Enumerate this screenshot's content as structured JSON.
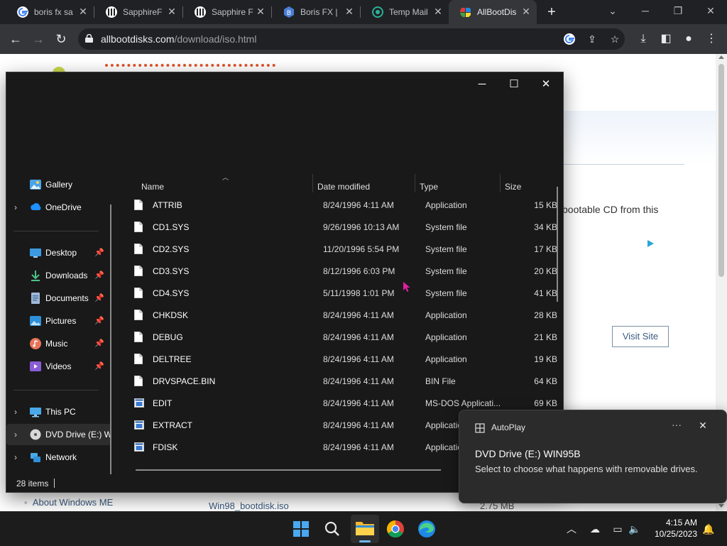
{
  "browser": {
    "tabs": [
      {
        "label": "boris fx sa",
        "icon": "google-icon"
      },
      {
        "label": "SapphireF",
        "icon": "museum-icon"
      },
      {
        "label": "Sapphire F",
        "icon": "museum-icon"
      },
      {
        "label": "Boris FX |",
        "icon": "borisfx-icon"
      },
      {
        "label": "Temp Mail",
        "icon": "tempmail-icon"
      },
      {
        "label": "AllBootDis",
        "icon": "allbootdisks-icon"
      }
    ],
    "url_domain": "allbootdisks.com",
    "url_path": "/download/iso.html"
  },
  "webpage": {
    "partial_text": "bootable CD from this",
    "visit_button": "Visit Site",
    "link_about": "About Windows ME",
    "file_name": "Win98_bootdisk.iso",
    "file_size": "2.75 MB"
  },
  "explorer": {
    "nav": [
      {
        "label": "Gallery",
        "icon": "gallery-icon",
        "chevron": false,
        "pinned": false
      },
      {
        "label": "OneDrive",
        "icon": "onedrive-icon",
        "chevron": true,
        "pinned": false
      },
      {
        "label": "Desktop",
        "icon": "desktop-icon",
        "chevron": false,
        "pinned": true
      },
      {
        "label": "Downloads",
        "icon": "downloads-icon",
        "chevron": false,
        "pinned": true
      },
      {
        "label": "Documents",
        "icon": "documents-icon",
        "chevron": false,
        "pinned": true
      },
      {
        "label": "Pictures",
        "icon": "pictures-icon",
        "chevron": false,
        "pinned": true
      },
      {
        "label": "Music",
        "icon": "music-icon",
        "chevron": false,
        "pinned": true
      },
      {
        "label": "Videos",
        "icon": "videos-icon",
        "chevron": false,
        "pinned": true
      },
      {
        "label": "This PC",
        "icon": "this-pc-icon",
        "chevron": true,
        "pinned": false
      },
      {
        "label": "DVD Drive (E:) W",
        "icon": "dvd-drive-icon",
        "chevron": true,
        "pinned": false
      },
      {
        "label": "Network",
        "icon": "network-icon",
        "chevron": true,
        "pinned": false
      }
    ],
    "columns": {
      "name": "Name",
      "date": "Date modified",
      "type": "Type",
      "size": "Size"
    },
    "files": [
      {
        "name": "ATTRIB",
        "date": "8/24/1996 4:11 AM",
        "type": "Application",
        "size": "15 KB",
        "icon": "file-icon"
      },
      {
        "name": "CD1.SYS",
        "date": "9/26/1996 10:13 AM",
        "type": "System file",
        "size": "34 KB",
        "icon": "file-icon"
      },
      {
        "name": "CD2.SYS",
        "date": "11/20/1996 5:54 PM",
        "type": "System file",
        "size": "17 KB",
        "icon": "file-icon"
      },
      {
        "name": "CD3.SYS",
        "date": "8/12/1996 6:03 PM",
        "type": "System file",
        "size": "20 KB",
        "icon": "file-icon"
      },
      {
        "name": "CD4.SYS",
        "date": "5/11/1998 1:01 PM",
        "type": "System file",
        "size": "41 KB",
        "icon": "file-icon"
      },
      {
        "name": "CHKDSK",
        "date": "8/24/1996 4:11 AM",
        "type": "Application",
        "size": "28 KB",
        "icon": "file-icon"
      },
      {
        "name": "DEBUG",
        "date": "8/24/1996 4:11 AM",
        "type": "Application",
        "size": "21 KB",
        "icon": "file-icon"
      },
      {
        "name": "DELTREE",
        "date": "8/24/1996 4:11 AM",
        "type": "Application",
        "size": "19 KB",
        "icon": "file-icon"
      },
      {
        "name": "DRVSPACE.BIN",
        "date": "8/24/1996 4:11 AM",
        "type": "BIN File",
        "size": "64 KB",
        "icon": "file-icon"
      },
      {
        "name": "EDIT",
        "date": "8/24/1996 4:11 AM",
        "type": "MS-DOS Applicati...",
        "size": "69 KB",
        "icon": "dos-app-icon"
      },
      {
        "name": "EXTRACT",
        "date": "8/24/1996 4:11 AM",
        "type": "Application",
        "size": "",
        "icon": "dos-app-icon"
      },
      {
        "name": "FDISK",
        "date": "8/24/1996 4:11 AM",
        "type": "Application",
        "size": "",
        "icon": "dos-app-icon"
      }
    ],
    "status": "28 items"
  },
  "autoplay": {
    "app": "AutoPlay",
    "title": "DVD Drive (E:) WIN95B",
    "body": "Select to choose what happens with removable drives."
  },
  "taskbar": {
    "time": "4:15 AM",
    "date": "10/25/2023"
  },
  "colors": {
    "explorer_bg": "#191919",
    "accent_blue": "#0078d4",
    "chrome_dark": "#202124"
  }
}
